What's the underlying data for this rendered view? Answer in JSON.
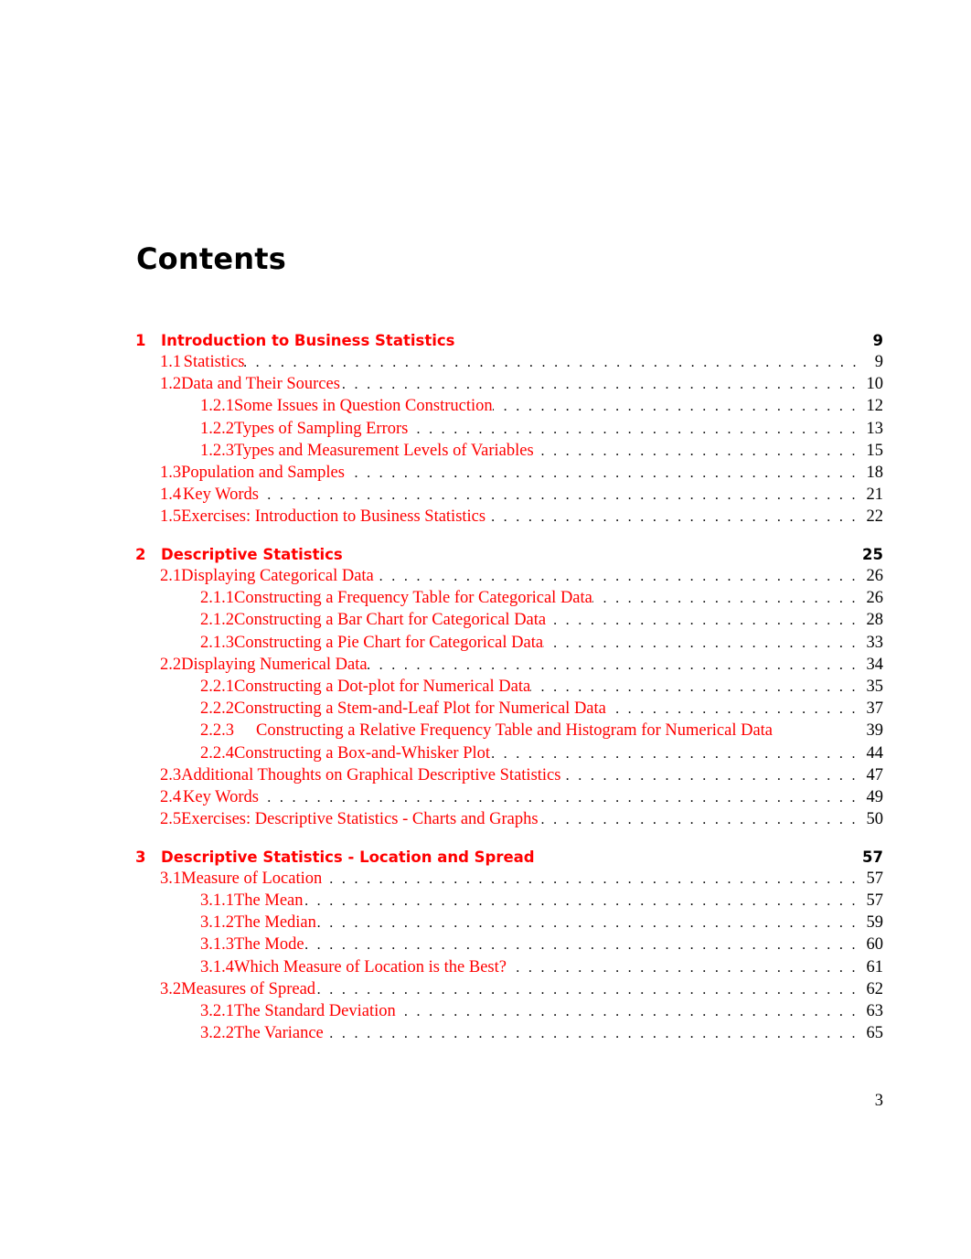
{
  "page_title": "Contents",
  "page_number": "3",
  "colors": {
    "link": "#ff0000",
    "text": "#000000"
  },
  "chapters": [
    {
      "num": "1",
      "title": "Introduction to Business Statistics",
      "page": "9",
      "entries": [
        {
          "level": "section",
          "num": "1.1",
          "title": "Statistics",
          "page": "9"
        },
        {
          "level": "section",
          "num": "1.2",
          "title": "Data and Their Sources",
          "page": "10"
        },
        {
          "level": "subsection",
          "num": "1.2.1",
          "title": "Some Issues in Question Construction",
          "page": "12"
        },
        {
          "level": "subsection",
          "num": "1.2.2",
          "title": "Types of Sampling Errors",
          "page": "13"
        },
        {
          "level": "subsection",
          "num": "1.2.3",
          "title": "Types and Measurement Levels of Variables",
          "page": "15"
        },
        {
          "level": "section",
          "num": "1.3",
          "title": "Population and Samples",
          "page": "18"
        },
        {
          "level": "section",
          "num": "1.4",
          "title": "Key Words",
          "page": "21"
        },
        {
          "level": "section",
          "num": "1.5",
          "title": "Exercises: Introduction to Business Statistics",
          "page": "22"
        }
      ]
    },
    {
      "num": "2",
      "title": "Descriptive Statistics",
      "page": "25",
      "entries": [
        {
          "level": "section",
          "num": "2.1",
          "title": "Displaying Categorical Data",
          "page": "26"
        },
        {
          "level": "subsection",
          "num": "2.1.1",
          "title": "Constructing a Frequency Table for Categorical Data",
          "page": "26"
        },
        {
          "level": "subsection",
          "num": "2.1.2",
          "title": "Constructing a Bar Chart for Categorical Data",
          "page": "28"
        },
        {
          "level": "subsection",
          "num": "2.1.3",
          "title": "Constructing a Pie Chart for Categorical Data",
          "page": "33"
        },
        {
          "level": "section",
          "num": "2.2",
          "title": "Displaying Numerical Data",
          "page": "34"
        },
        {
          "level": "subsection",
          "num": "2.2.1",
          "title": "Constructing a Dot-plot for Numerical Data",
          "page": "35"
        },
        {
          "level": "subsection",
          "num": "2.2.2",
          "title": "Constructing a Stem-and-Leaf Plot for Numerical Data",
          "page": "37"
        },
        {
          "level": "subsection",
          "num": "2.2.3",
          "title": "Constructing a Relative Frequency Table and Histogram for Numerical Data",
          "page": "39",
          "no_leader": true
        },
        {
          "level": "subsection",
          "num": "2.2.4",
          "title": "Constructing a Box-and-Whisker Plot",
          "page": "44"
        },
        {
          "level": "section",
          "num": "2.3",
          "title": "Additional Thoughts on Graphical Descriptive Statistics",
          "page": "47"
        },
        {
          "level": "section",
          "num": "2.4",
          "title": "Key Words",
          "page": "49"
        },
        {
          "level": "section",
          "num": "2.5",
          "title": "Exercises: Descriptive Statistics - Charts and Graphs",
          "page": "50"
        }
      ]
    },
    {
      "num": "3",
      "title": "Descriptive Statistics - Location and Spread",
      "page": "57",
      "entries": [
        {
          "level": "section",
          "num": "3.1",
          "title": "Measure of Location",
          "page": "57"
        },
        {
          "level": "subsection",
          "num": "3.1.1",
          "title": "The Mean",
          "page": "57"
        },
        {
          "level": "subsection",
          "num": "3.1.2",
          "title": "The Median",
          "page": "59"
        },
        {
          "level": "subsection",
          "num": "3.1.3",
          "title": "The Mode",
          "page": "60"
        },
        {
          "level": "subsection",
          "num": "3.1.4",
          "title": "Which Measure of Location is the Best?",
          "page": "61"
        },
        {
          "level": "section",
          "num": "3.2",
          "title": "Measures of Spread",
          "page": "62"
        },
        {
          "level": "subsection",
          "num": "3.2.1",
          "title": "The Standard Deviation",
          "page": "63"
        },
        {
          "level": "subsection",
          "num": "3.2.2",
          "title": "The Variance",
          "page": "65"
        }
      ]
    }
  ]
}
